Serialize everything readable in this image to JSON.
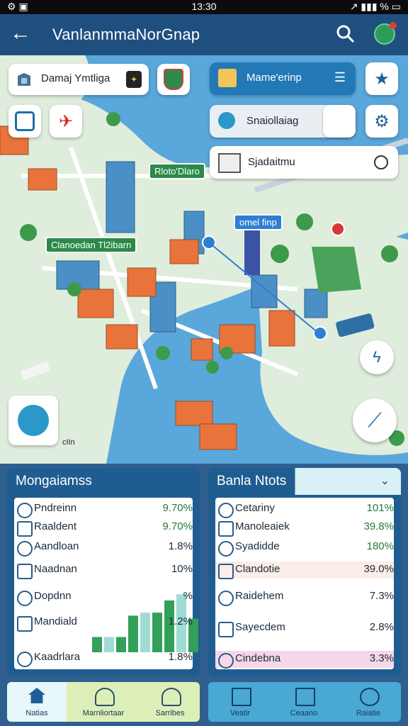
{
  "status_bar": {
    "time": "13:30",
    "left_icons": "⚙ ▣",
    "right_icons": "↗ ▮▮▮ % ▭"
  },
  "app_bar": {
    "title": "VanlanmmaNorGnap"
  },
  "map_overlays": {
    "location_card": "Damaj Ymtliga",
    "layer_button": "Mame'erinp",
    "search_field": "Snaiollaiag",
    "list_field": "Sjadaitmu",
    "map_tags": [
      "Rloto'Dlaro",
      "Clanoedan Tl2ibarn",
      "omel finp"
    ],
    "map_small_label": "cIIn"
  },
  "left_panel": {
    "title": "Mongaiamss",
    "rows": [
      {
        "label": "Pndreinn",
        "value": "9.70%"
      },
      {
        "label": "Raaldent",
        "value": "9.70%"
      },
      {
        "label": "Aandloan",
        "value": "1.8%"
      },
      {
        "label": "Naadnan",
        "value": "10%"
      },
      {
        "label": "Dopdnn",
        "value": "%"
      },
      {
        "label": "Mandiald",
        "value": "1.2%"
      },
      {
        "label": "Kaadrlara",
        "value": "1.8%"
      }
    ],
    "mini_chart": [
      0.25,
      0.25,
      0.25,
      0.6,
      0.65,
      0.65,
      0.85,
      0.95,
      0.55
    ]
  },
  "right_panel": {
    "title": "Banla Ntots",
    "rows": [
      {
        "label": "Cetariny",
        "value": "101%"
      },
      {
        "label": "Manoleaiek",
        "value": "39.8%"
      },
      {
        "label": "Syadidde",
        "value": "180%"
      },
      {
        "label": "Clandotie",
        "value": "39.0%"
      },
      {
        "label": "Raidehem",
        "value": "7.3%"
      },
      {
        "label": "Sayecdem",
        "value": "2.8%"
      },
      {
        "label": "Cindebna",
        "value": "3.3%"
      }
    ]
  },
  "bottom_nav": {
    "left": [
      {
        "label": "Natias"
      },
      {
        "label": "Marnliortaar"
      },
      {
        "label": "Sarribes"
      }
    ],
    "right": [
      {
        "label": "Veatir"
      },
      {
        "label": "Ceaano"
      },
      {
        "label": "Raiatie"
      }
    ]
  },
  "colors": {
    "app_bar": "#1f4f7f",
    "panel_head": "#1f5c90",
    "water": "#5aa7db",
    "land": "#dfeddc",
    "accent": "#3aa15c"
  }
}
